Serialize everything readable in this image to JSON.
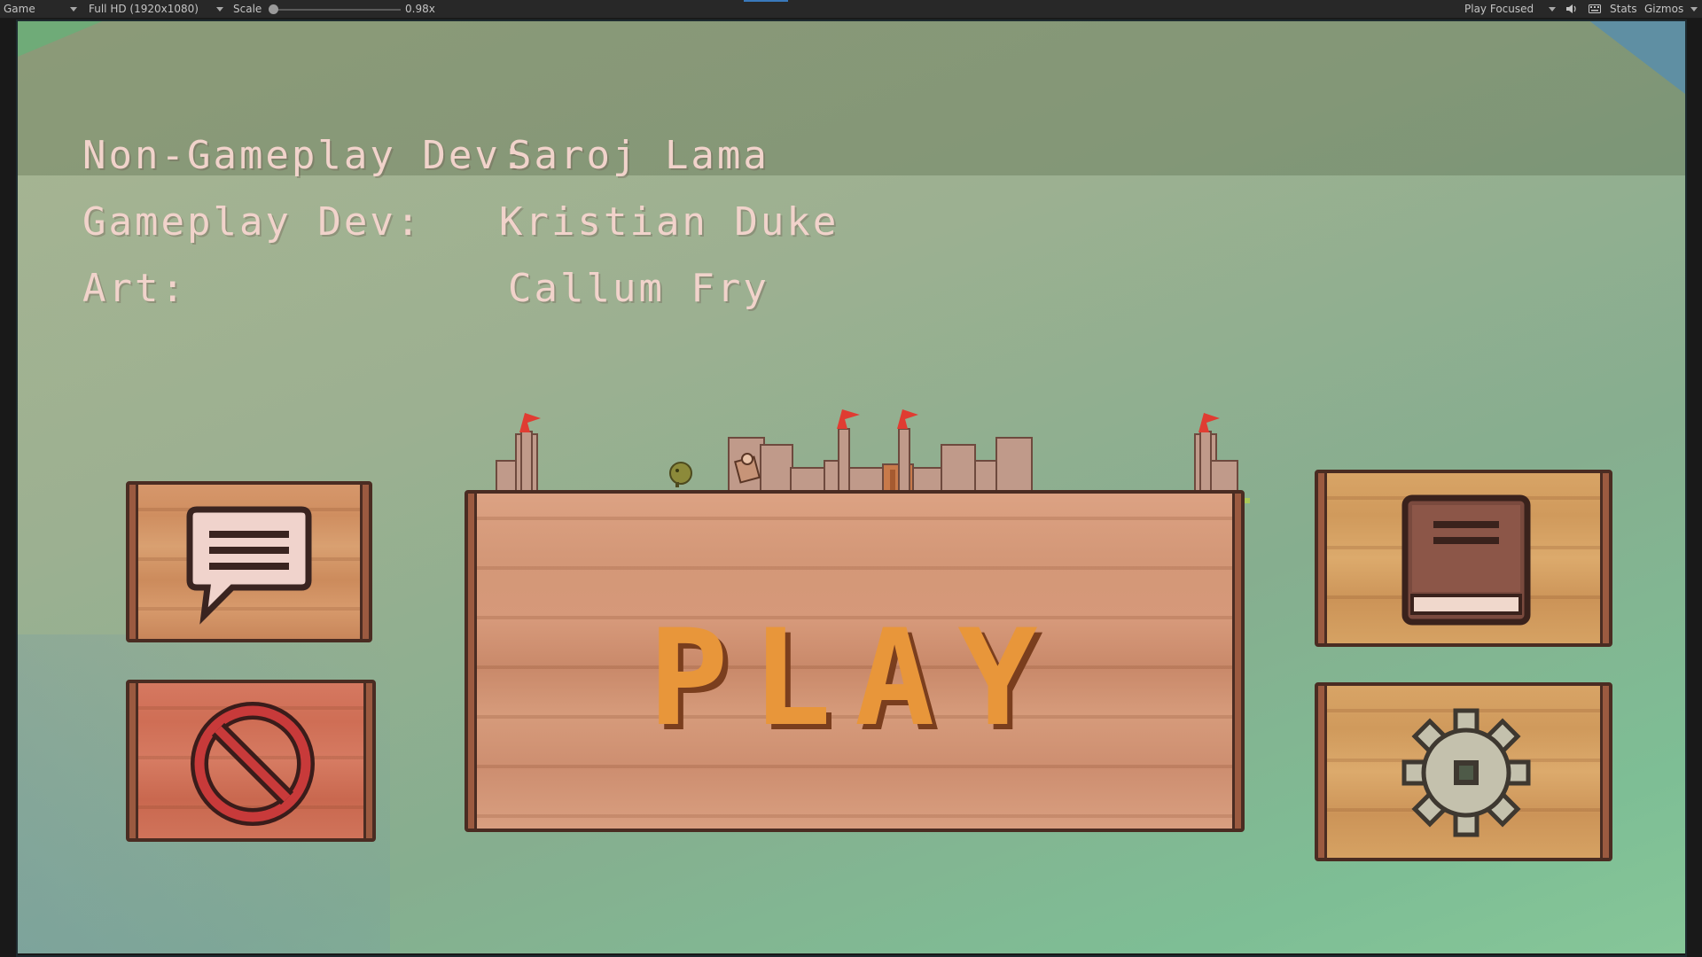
{
  "toolbar": {
    "tab_label": "Game",
    "resolution": "Full HD (1920x1080)",
    "scale_label": "Scale",
    "scale_value": "0.98x",
    "play_mode": "Play Focused",
    "stats_label": "Stats",
    "gizmos_label": "Gizmos",
    "scale_level": 0.02
  },
  "credits": [
    {
      "role": "Non-Gameplay Dev:",
      "name": "Saroj Lama"
    },
    {
      "role": "Gameplay Dev:",
      "name": "Kristian Duke"
    },
    {
      "role": "Art:",
      "name": "Callum Fry"
    }
  ],
  "menu": {
    "play_label": "PLAY",
    "chat_icon": "speech-bubble-icon",
    "quit_icon": "no-entry-icon",
    "book_icon": "book-icon",
    "settings_icon": "gear-icon"
  },
  "colors": {
    "credit_text": "#f1d3cb",
    "play_text": "#e8963a",
    "flag": "#e03c32"
  }
}
